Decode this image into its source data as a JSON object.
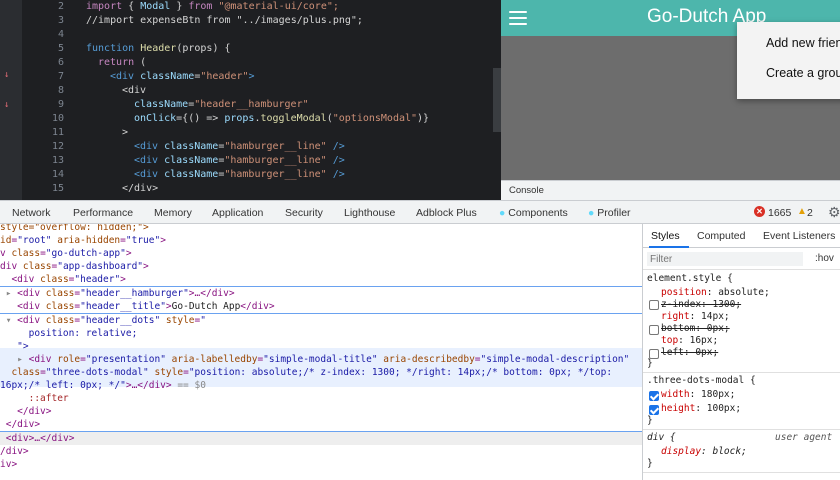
{
  "editor": {
    "line_numbers": [
      "2",
      "3",
      "4",
      "5",
      "6",
      "7",
      "8",
      "9",
      "10",
      "11",
      "12",
      "13",
      "14",
      "15"
    ],
    "lines": {
      "l2": {
        "kw": "import",
        "brace_open": " { ",
        "name": "Modal",
        "brace_close": " } ",
        "from": "from",
        "str": " \"@material-ui/core\";"
      },
      "l3": "//import expenseBtn from \"../images/plus.png\";",
      "l5": {
        "kw": "function",
        "name": " Header",
        "args": "(props) {"
      },
      "l6": {
        "kw": "return",
        "rest": " ("
      },
      "l7": {
        "open": "<div",
        "attr": " className",
        "eq": "=",
        "val": "\"header\"",
        "close": ">"
      },
      "l8": "<div",
      "l9": {
        "attr": "className",
        "eq": "=",
        "val": "\"header__hamburger\""
      },
      "l10": {
        "attr": "onClick",
        "rest1": "={() => ",
        "obj": "props",
        "dot": ".",
        "fn": "toggleModal",
        "paren": "(",
        "val": "\"optionsModal\"",
        "tail": ")}"
      },
      "l11": ">",
      "l12": {
        "open": "<div",
        "attr": " className",
        "eq": "=",
        "val": "\"hamburger__line\"",
        "close": " />"
      },
      "l13": {
        "open": "<div",
        "attr": " className",
        "eq": "=",
        "val": "\"hamburger__line\"",
        "close": " />"
      },
      "l14": {
        "open": "<div",
        "attr": " className",
        "eq": "=",
        "val": "\"hamburger__line\"",
        "close": " />"
      },
      "l15": "</div>"
    }
  },
  "preview": {
    "app_title": "Go-Dutch App",
    "menu_items": [
      "Add new frien",
      "Create a grou"
    ],
    "appbar_color": "#4db6ac"
  },
  "console_drawer": {
    "label": "Console"
  },
  "devtools_tabs": [
    "Network",
    "Performance",
    "Memory",
    "Application",
    "Security",
    "Lighthouse",
    "Adblock Plus",
    "Components",
    "Profiler"
  ],
  "status": {
    "errors": "1665",
    "warnings": "2",
    "error_icon": "close-circle-icon",
    "warning_icon": "warning-icon",
    "settings_icon": "gear-icon"
  },
  "elements": {
    "r0": "style=\"overflow: hidden;\">",
    "r1": {
      "a": "id",
      "v": "\"root\"",
      "a2": " aria-hidden",
      "v2": "\"true\"",
      "end": ">"
    },
    "r2": {
      "t": "v ",
      "a": "class",
      "v": "\"go-dutch-app\"",
      "end": ">"
    },
    "r3": {
      "t": "div ",
      "a": "class",
      "v": "\"app-dashboard\"",
      "end": ">"
    },
    "r4": {
      "t": "<div ",
      "a": "class",
      "v": "\"header\"",
      "end": ">"
    },
    "r5": {
      "t": "<div ",
      "a": "class",
      "v": "\"header__hamburger\"",
      "mid": ">…</",
      "t2": "div",
      "end": ">"
    },
    "r6": {
      "t": "<div ",
      "a": "class",
      "v": "\"header__title\"",
      "mid": ">",
      "text": "Go-Dutch App",
      "t2": "</div>"
    },
    "r7": {
      "t": "<div ",
      "a": "class",
      "v": "\"header__dots\"",
      "a2": " style",
      "v2": "\""
    },
    "r8": {
      "p": "position",
      "val": ": relative;"
    },
    "r9": "\">",
    "r10": {
      "t": "<div ",
      "a": "role",
      "v": "\"presentation\"",
      "a2": " aria-labelledby",
      "v2": "\"simple-modal-title\"",
      "a3": " aria-describedby",
      "v3": "\"simple-modal-description\""
    },
    "r11": {
      "a": "class",
      "v": "\"three-dots-modal\"",
      "a2": " style",
      "v2": "\"position: absolute;/* z-index: 1300; */right: 14px;/* bottom: 0px; */top:"
    },
    "r12": {
      "v": "16px;/* left: 0px; */\"",
      "end": ">…</div>",
      "eq": " == $0"
    },
    "r13": "::after",
    "r14": "</div>",
    "r15": "</div>",
    "r16": {
      "t": "<div",
      "mid": ">…</",
      "t2": "div",
      "end": ">"
    },
    "r17": "/div>",
    "r18": "iv>"
  },
  "styles": {
    "tabs": [
      "Styles",
      "Computed",
      "Event Listeners"
    ],
    "filter_placeholder": "Filter",
    "hov": ":hov",
    "element_style_selector": "element.style {",
    "decls": [
      {
        "name": "position",
        "value": ": absolute;",
        "disabled": false
      },
      {
        "name": "z-index",
        "value": ": 1300;",
        "disabled": true
      },
      {
        "name": "right",
        "value": ": 14px;",
        "disabled": false
      },
      {
        "name": "bottom",
        "value": ": 0px;",
        "disabled": true
      },
      {
        "name": "top",
        "value": ": 16px;",
        "disabled": false
      },
      {
        "name": "left",
        "value": ": 0px;",
        "disabled": true
      }
    ],
    "close_brace": "}",
    "rule2_selector": ".three-dots-modal {",
    "rule2_decls": [
      {
        "name": "width",
        "value": ": 180px;"
      },
      {
        "name": "height",
        "value": ": 100px;"
      }
    ],
    "rule3_selector": "div {",
    "rule3_source": "user agent",
    "rule3_decl": {
      "name": "display",
      "value": ": block;"
    }
  }
}
